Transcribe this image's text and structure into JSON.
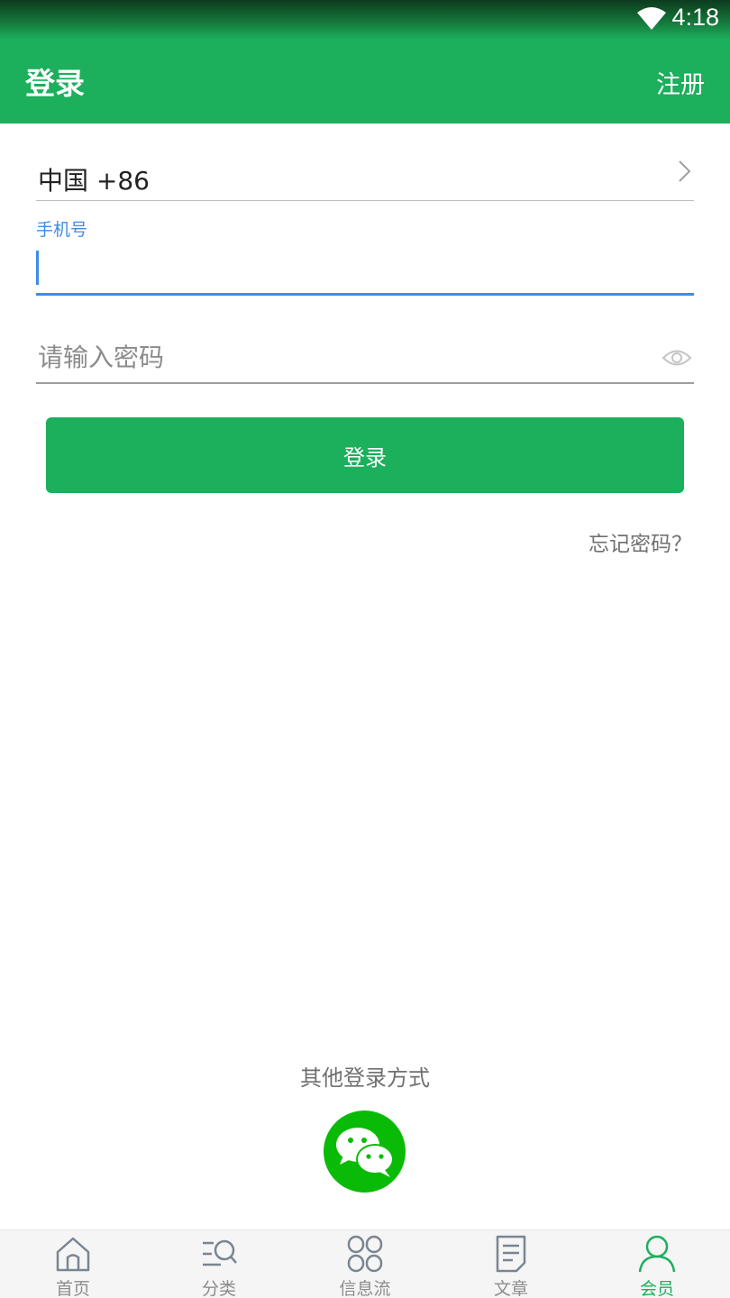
{
  "status_bar": {
    "time": "4:18"
  },
  "header": {
    "title": "登录",
    "register": "注册"
  },
  "form": {
    "country": "中国 +86",
    "phone_label": "手机号",
    "phone_value": "",
    "password_placeholder": "请输入密码",
    "login_button": "登录",
    "forgot_password": "忘记密码？"
  },
  "other_login": {
    "label": "其他登录方式",
    "icon": "wechat-icon"
  },
  "tabbar": {
    "items": [
      {
        "label": "首页",
        "icon": "home-icon"
      },
      {
        "label": "分类",
        "icon": "category-search-icon"
      },
      {
        "label": "信息流",
        "icon": "grid-icon"
      },
      {
        "label": "文章",
        "icon": "article-icon"
      },
      {
        "label": "会员",
        "icon": "member-icon",
        "active": true
      }
    ]
  },
  "colors": {
    "primary": "#1caf5c",
    "focus": "#3d8ce8",
    "wechat": "#09bb07"
  }
}
